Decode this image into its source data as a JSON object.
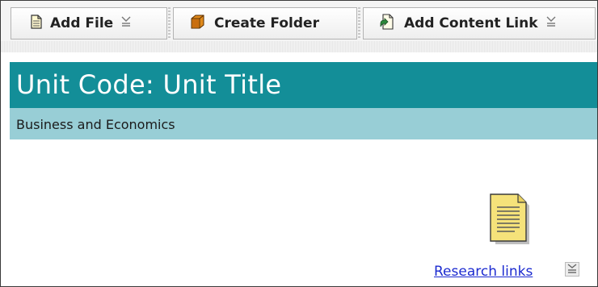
{
  "toolbar": {
    "add_file_label": "Add File",
    "create_folder_label": "Create Folder",
    "add_content_link_label": "Add Content Link"
  },
  "header": {
    "title": "Unit Code: Unit Title",
    "subtitle": "Business and Economics"
  },
  "content": {
    "items": [
      {
        "label": "Research links",
        "icon": "document-icon"
      }
    ]
  },
  "colors": {
    "title_bar": "#138e98",
    "subtitle_bar": "#98ced6",
    "link": "#1c2bd0"
  }
}
